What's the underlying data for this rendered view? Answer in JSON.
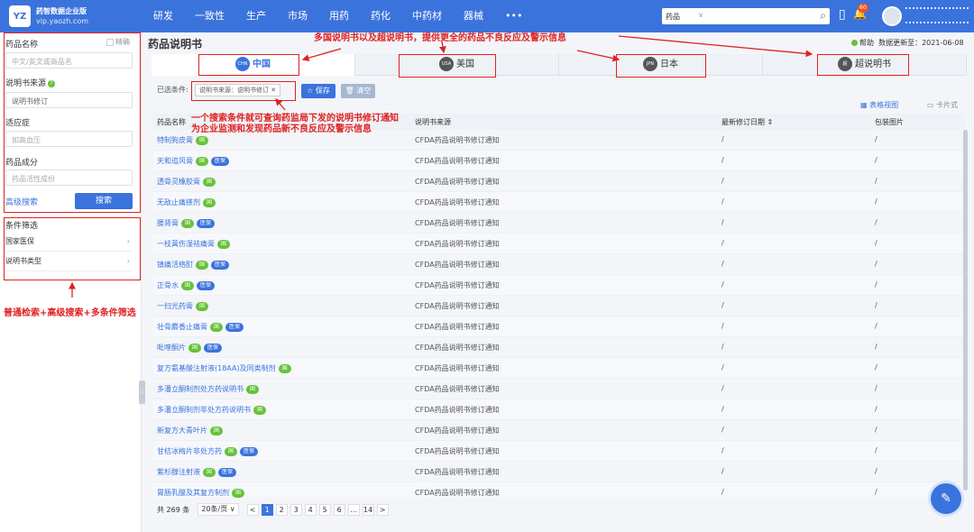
{
  "brand": {
    "logo": "YZ",
    "name": "药智数据企业版",
    "url": "vip.yaozh.com"
  },
  "nav": [
    "研发",
    "一致性",
    "生产",
    "市场",
    "用药",
    "药化",
    "中药材",
    "器械",
    "•••"
  ],
  "search": {
    "category": "药品",
    "arrow": "∨"
  },
  "notifications": {
    "count": "60"
  },
  "sidebar": {
    "fields": [
      {
        "label": "药品名称",
        "placeholder": "中文/英文或商品名"
      },
      {
        "label": "说明书来源",
        "placeholder": "说明书修订"
      },
      {
        "label": "适应症",
        "placeholder": "如高血压"
      },
      {
        "label": "药品成分",
        "placeholder": "药品活性成份"
      }
    ],
    "fuzzy": "精确",
    "advanced": "高级搜索",
    "search_btn": "搜索",
    "filter_title": "条件筛选",
    "filters": [
      "国家医保",
      "说明书类型"
    ]
  },
  "page": {
    "title": "药品说明书",
    "help": "帮助",
    "updated": "数据更新至：2021-06-08",
    "tabs": [
      {
        "code": "CHN",
        "label": "中国",
        "active": true
      },
      {
        "code": "USA",
        "label": "美国",
        "active": false
      },
      {
        "code": "JPN",
        "label": "日本",
        "active": false
      },
      {
        "code": "超",
        "label": "超说明书",
        "active": false
      }
    ],
    "cond_label": "已选条件:",
    "cond_chip": "说明书来源：说明书修订 ✕",
    "save": "☆ 保存",
    "clear": "🗑 清空",
    "view_table": "▦ 表格视图",
    "view_card": "▭ 卡片式",
    "columns": [
      "药品名称",
      "说明书来源",
      "最新修订日期 ⇕",
      "包装图片"
    ]
  },
  "rows": [
    {
      "name": "特制狗皮膏",
      "tags": [
        "国"
      ],
      "source": "CFDA药品说明书修订通知",
      "date": "/",
      "img": "/"
    },
    {
      "name": "天和追风膏",
      "tags": [
        "国",
        "医保"
      ],
      "source": "CFDA药品说明书修订通知",
      "date": "/",
      "img": "/"
    },
    {
      "name": "透骨灵橡胶膏",
      "tags": [
        "国"
      ],
      "source": "CFDA药品说明书修订通知",
      "date": "/",
      "img": "/"
    },
    {
      "name": "无敌止痛搽剂",
      "tags": [
        "国"
      ],
      "source": "CFDA药品说明书修订通知",
      "date": "/",
      "img": "/"
    },
    {
      "name": "腰肾膏",
      "tags": [
        "国",
        "医保"
      ],
      "source": "CFDA药品说明书修订通知",
      "date": "/",
      "img": "/"
    },
    {
      "name": "一枝蒿伤湿祛痛膏",
      "tags": [
        "国"
      ],
      "source": "CFDA药品说明书修订通知",
      "date": "/",
      "img": "/"
    },
    {
      "name": "镇痛活络酊",
      "tags": [
        "国",
        "医保"
      ],
      "source": "CFDA药品说明书修订通知",
      "date": "/",
      "img": "/"
    },
    {
      "name": "正骨水",
      "tags": [
        "国",
        "医保"
      ],
      "source": "CFDA药品说明书修订通知",
      "date": "/",
      "img": "/"
    },
    {
      "name": "一扫光药膏",
      "tags": [
        "国"
      ],
      "source": "CFDA药品说明书修订通知",
      "date": "/",
      "img": "/"
    },
    {
      "name": "壮骨麝香止痛膏",
      "tags": [
        "国",
        "医保"
      ],
      "source": "CFDA药品说明书修订通知",
      "date": "/",
      "img": "/"
    },
    {
      "name": "吡喹酮片",
      "tags": [
        "国",
        "医保"
      ],
      "source": "CFDA药品说明书修订通知",
      "date": "/",
      "img": "/"
    },
    {
      "name": "复方氨基酸注射液(18AA)及同类制剂",
      "tags": [
        "国"
      ],
      "source": "CFDA药品说明书修订通知",
      "date": "/",
      "img": "/"
    },
    {
      "name": "多潘立酮制剂处方药说明书",
      "tags": [
        "国"
      ],
      "source": "CFDA药品说明书修订通知",
      "date": "/",
      "img": "/"
    },
    {
      "name": "多潘立酮制剂非处方药说明书",
      "tags": [
        "国"
      ],
      "source": "CFDA药品说明书修订通知",
      "date": "/",
      "img": "/"
    },
    {
      "name": "新复方大青叶片",
      "tags": [
        "国"
      ],
      "source": "CFDA药品说明书修订通知",
      "date": "/",
      "img": "/"
    },
    {
      "name": "甘桔冰梅片非处方药",
      "tags": [
        "国",
        "医保"
      ],
      "source": "CFDA药品说明书修订通知",
      "date": "/",
      "img": "/"
    },
    {
      "name": "紫杉醇注射液",
      "tags": [
        "国",
        "医保"
      ],
      "source": "CFDA药品说明书修订通知",
      "date": "/",
      "img": "/"
    },
    {
      "name": "胃肠乳酸及其复方制剂",
      "tags": [
        "国"
      ],
      "source": "CFDA药品说明书修订通知",
      "date": "/",
      "img": "/"
    }
  ],
  "pager": {
    "total": "共 269 条",
    "size": "20条/页 ∨",
    "prev": "<",
    "pages": [
      "1",
      "2",
      "3",
      "4",
      "5",
      "6",
      "...",
      "14"
    ],
    "next": ">"
  },
  "annotations": {
    "top": "多国说明书以及超说明书，提供更全的药品不良反应及警示信息",
    "mid1": "一个搜索条件就可查询药监局下发的说明书修订通知",
    "mid2": "为企业监测和发现药品新不良反应及警示信息",
    "left": "普通检索+高级搜索+多条件筛选"
  },
  "icons": {
    "search": "⌕",
    "phone": "▯",
    "bell": "🔔",
    "chevron": "›",
    "fab": "✎"
  }
}
